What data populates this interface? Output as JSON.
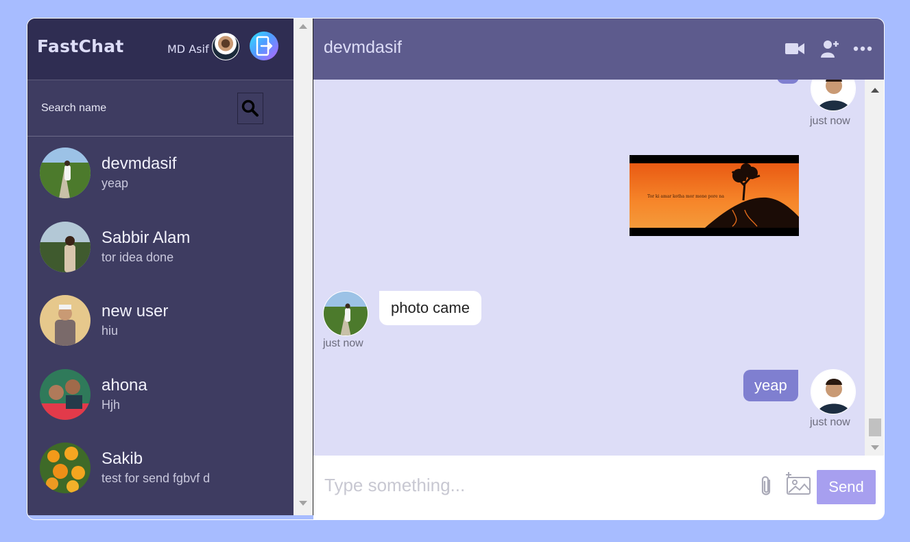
{
  "navbar": {
    "logo": "FastChat",
    "user_name": "MD Asif"
  },
  "search": {
    "placeholder": "Search name"
  },
  "chats": [
    {
      "name": "devmdasif",
      "last": "yeap"
    },
    {
      "name": "Sabbir Alam",
      "last": "tor idea done"
    },
    {
      "name": "new user",
      "last": "hiu"
    },
    {
      "name": "ahona",
      "last": "Hjh"
    },
    {
      "name": "Sakib",
      "last": "test for send fgbvf d"
    }
  ],
  "chat": {
    "title": "devmdasif",
    "image_caption": "Tor ki amar kotha mor mone pore na",
    "messages": [
      {
        "owner": true,
        "text": "",
        "time": "just now"
      },
      {
        "owner": false,
        "text": "photo came",
        "time": "just now"
      },
      {
        "owner": true,
        "text": "yeap",
        "time": "just now"
      }
    ]
  },
  "input": {
    "placeholder": "Type something...",
    "send_label": "Send"
  },
  "colors": {
    "background": "#a7bcff",
    "sidebar": "#3e3c61",
    "navbar": "#2f2d52",
    "chat_header": "#5d5b8d",
    "chat_bg": "#ddddf7",
    "owner_bubble": "#7f7fd0",
    "send_button": "#a79fef"
  }
}
